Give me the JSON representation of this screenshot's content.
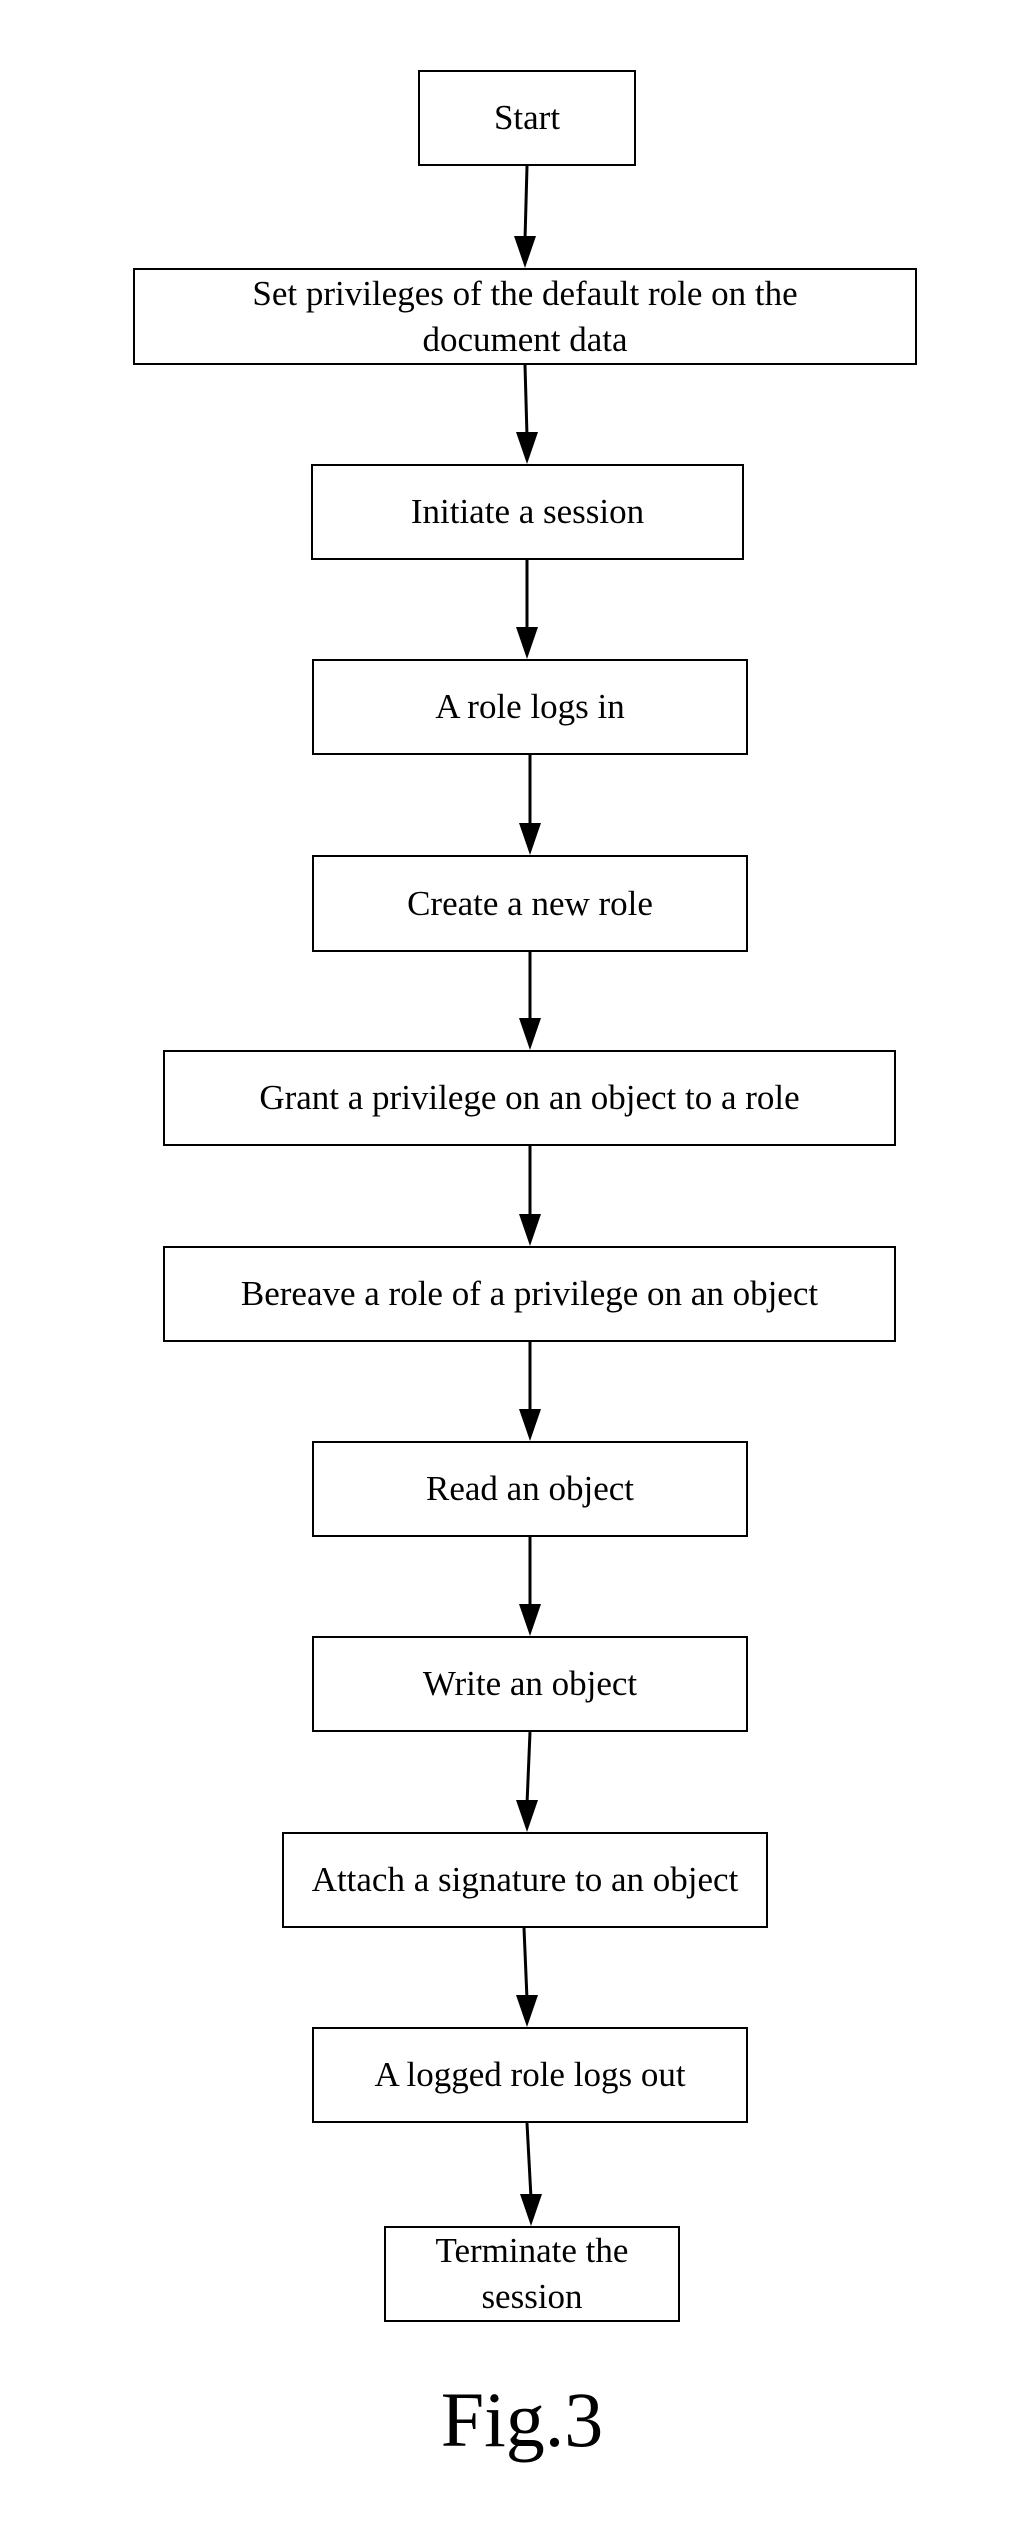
{
  "figure": {
    "caption": "Fig.3",
    "steps": [
      {
        "id": "start",
        "label": "Start"
      },
      {
        "id": "set-default-privileges",
        "label": "Set privileges of the default role on the document data"
      },
      {
        "id": "initiate-session",
        "label": "Initiate a session"
      },
      {
        "id": "role-logs-in",
        "label": "A role logs in"
      },
      {
        "id": "create-role",
        "label": "Create a new role"
      },
      {
        "id": "grant-privilege",
        "label": "Grant a privilege on an object to a role"
      },
      {
        "id": "revoke-privilege",
        "label": "Bereave a role of a privilege on an object"
      },
      {
        "id": "read-object",
        "label": "Read an object"
      },
      {
        "id": "write-object",
        "label": "Write an object"
      },
      {
        "id": "attach-signature",
        "label": "Attach a signature to an object"
      },
      {
        "id": "role-logs-out",
        "label": "A logged role logs out"
      },
      {
        "id": "terminate-session",
        "label": "Terminate the session"
      }
    ],
    "edges": [
      {
        "from": "start",
        "to": "set-default-privileges"
      },
      {
        "from": "set-default-privileges",
        "to": "initiate-session"
      },
      {
        "from": "initiate-session",
        "to": "role-logs-in"
      },
      {
        "from": "role-logs-in",
        "to": "create-role"
      },
      {
        "from": "create-role",
        "to": "grant-privilege"
      },
      {
        "from": "grant-privilege",
        "to": "revoke-privilege"
      },
      {
        "from": "revoke-privilege",
        "to": "read-object"
      },
      {
        "from": "read-object",
        "to": "write-object"
      },
      {
        "from": "write-object",
        "to": "attach-signature"
      },
      {
        "from": "attach-signature",
        "to": "role-logs-out"
      },
      {
        "from": "role-logs-out",
        "to": "terminate-session"
      }
    ],
    "colors": {
      "stroke": "#000000",
      "background": "#ffffff"
    }
  }
}
